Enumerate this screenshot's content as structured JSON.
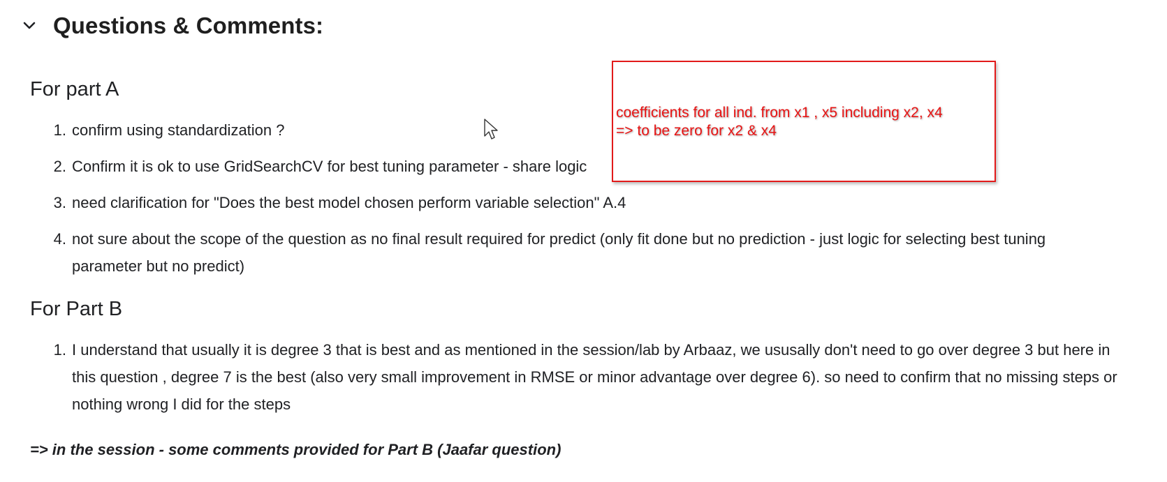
{
  "section": {
    "title": "Questions & Comments:",
    "chevron_icon": "chevron-down-icon"
  },
  "partA": {
    "heading": "For part A",
    "items": [
      {
        "num": "1.",
        "text": "confirm using standardization ?"
      },
      {
        "num": "2.",
        "text": "Confirm it is ok to use GridSearchCV for best tuning parameter - share logic"
      },
      {
        "num": "3.",
        "text": "need clarification for \"Does the best model chosen perform variable selection\" A.4"
      },
      {
        "num": "4.",
        "text": "not sure about the scope of the question as no final result required for predict (only fit done but no prediction - just logic for selecting best tuning parameter but no predict)"
      }
    ]
  },
  "partB": {
    "heading": "For Part B",
    "items": [
      {
        "num": "1.",
        "text": "I understand that usually it is degree 3 that is best and as mentioned in the session/lab by Arbaaz, we ususally don't need to go over degree 3 but here in this question , degree 7 is the best (also very small improvement in RMSE or minor advantage over degree 6). so need to confirm that no missing steps or nothing wrong I did for the steps"
      }
    ]
  },
  "conclusion": "=> in the session - some comments provided for Part B (Jaafar question)",
  "annotation": {
    "line1": "coefficients for all ind. from x1 , x5 including x2, x4",
    "line2": "=> to be zero for x2 & x4",
    "color": "#e81414"
  },
  "cursor_icon": "mouse-pointer-icon"
}
